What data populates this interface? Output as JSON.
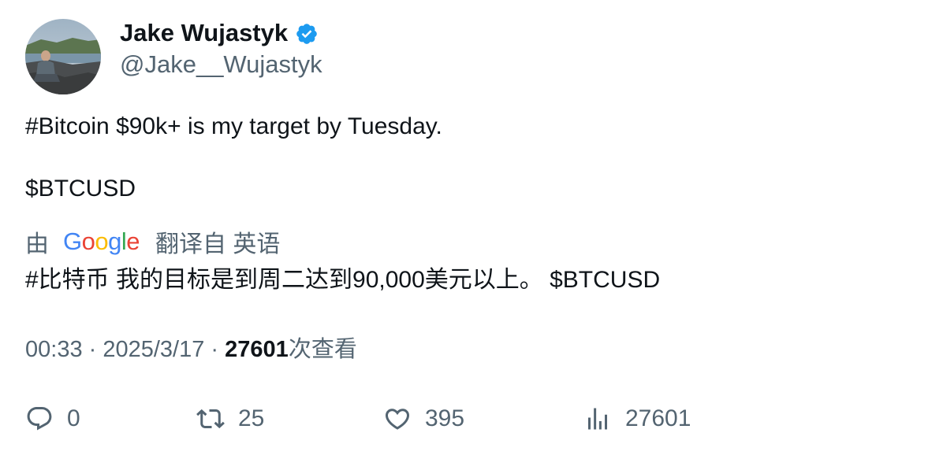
{
  "author": {
    "display_name": "Jake Wujastyk",
    "handle": "@Jake__Wujastyk",
    "verified": true,
    "verified_color": "#1d9bf0"
  },
  "tweet": {
    "line1": "#Bitcoin $90k+ is my target by Tuesday.",
    "line2": "$BTCUSD"
  },
  "translation": {
    "prefix": "由",
    "provider_logo_text": "Google",
    "suffix": "翻译自 英语",
    "text": "#比特币 我的目标是到周二达到90,000美元以上。 $BTCUSD"
  },
  "meta": {
    "time": "00:33",
    "separator": " · ",
    "date": "2025/3/17",
    "views_count": "27601",
    "views_label": "次查看"
  },
  "actions": {
    "reply_count": "0",
    "retweet_count": "25",
    "like_count": "395",
    "views_count": "27601"
  },
  "colors": {
    "text_primary": "#0f1419",
    "text_secondary": "#536471"
  }
}
